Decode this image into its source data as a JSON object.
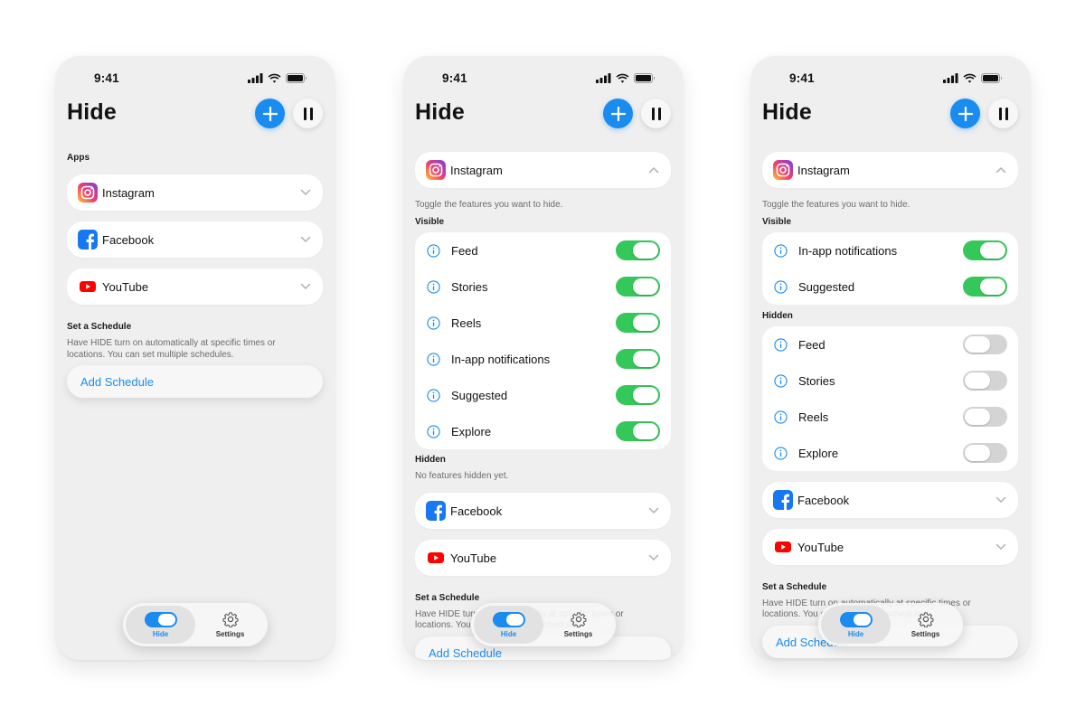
{
  "status": {
    "time": "9:41"
  },
  "header": {
    "title": "Hide",
    "add_icon": "plus-icon",
    "pause_icon": "pause-icon"
  },
  "colors": {
    "accent": "#1a8cf0",
    "toggle_on": "#34c759",
    "toggle_off": "#d4d4d4",
    "background": "#efefef",
    "card": "#ffffff"
  },
  "tabbar": {
    "hide_label": "Hide",
    "hide_icon": "toggle-icon",
    "settings_label": "Settings",
    "settings_icon": "gear-icon"
  },
  "schedule": {
    "heading": "Set a Schedule",
    "description": "Have HIDE turn on automatically at specific times or locations. You can set multiple schedules.",
    "description_line1": "Have HIDE turn on automatically at specific times or",
    "description_line2": "locations. You can set multiple schedules.",
    "add_label": "Add Schedule"
  },
  "screens": [
    {
      "apps_heading": "Apps",
      "apps": [
        {
          "name": "Instagram",
          "icon": "instagram-icon",
          "expanded": false
        },
        {
          "name": "Facebook",
          "icon": "facebook-icon",
          "expanded": false
        },
        {
          "name": "YouTube",
          "icon": "youtube-icon",
          "expanded": false
        }
      ]
    },
    {
      "expanded_app": {
        "name": "Instagram",
        "icon": "instagram-icon",
        "expanded": true
      },
      "instructions": "Toggle the features you want to hide.",
      "visible_heading": "Visible",
      "visible_features": [
        {
          "label": "Feed",
          "on": true
        },
        {
          "label": "Stories",
          "on": true
        },
        {
          "label": "Reels",
          "on": true
        },
        {
          "label": "In-app notifications",
          "on": true
        },
        {
          "label": "Suggested",
          "on": true
        },
        {
          "label": "Explore",
          "on": true
        }
      ],
      "hidden_heading": "Hidden",
      "hidden_empty": "No features hidden yet.",
      "other_apps": [
        {
          "name": "Facebook",
          "icon": "facebook-icon"
        },
        {
          "name": "YouTube",
          "icon": "youtube-icon"
        }
      ]
    },
    {
      "expanded_app": {
        "name": "Instagram",
        "icon": "instagram-icon",
        "expanded": true
      },
      "instructions": "Toggle the features you want to hide.",
      "visible_heading": "Visible",
      "visible_features": [
        {
          "label": "In-app notifications",
          "on": true
        },
        {
          "label": "Suggested",
          "on": true
        }
      ],
      "hidden_heading": "Hidden",
      "hidden_features": [
        {
          "label": "Feed",
          "on": false
        },
        {
          "label": "Stories",
          "on": false
        },
        {
          "label": "Reels",
          "on": false
        },
        {
          "label": "Explore",
          "on": false
        }
      ],
      "other_apps": [
        {
          "name": "Facebook",
          "icon": "facebook-icon"
        },
        {
          "name": "YouTube",
          "icon": "youtube-icon"
        }
      ]
    }
  ]
}
